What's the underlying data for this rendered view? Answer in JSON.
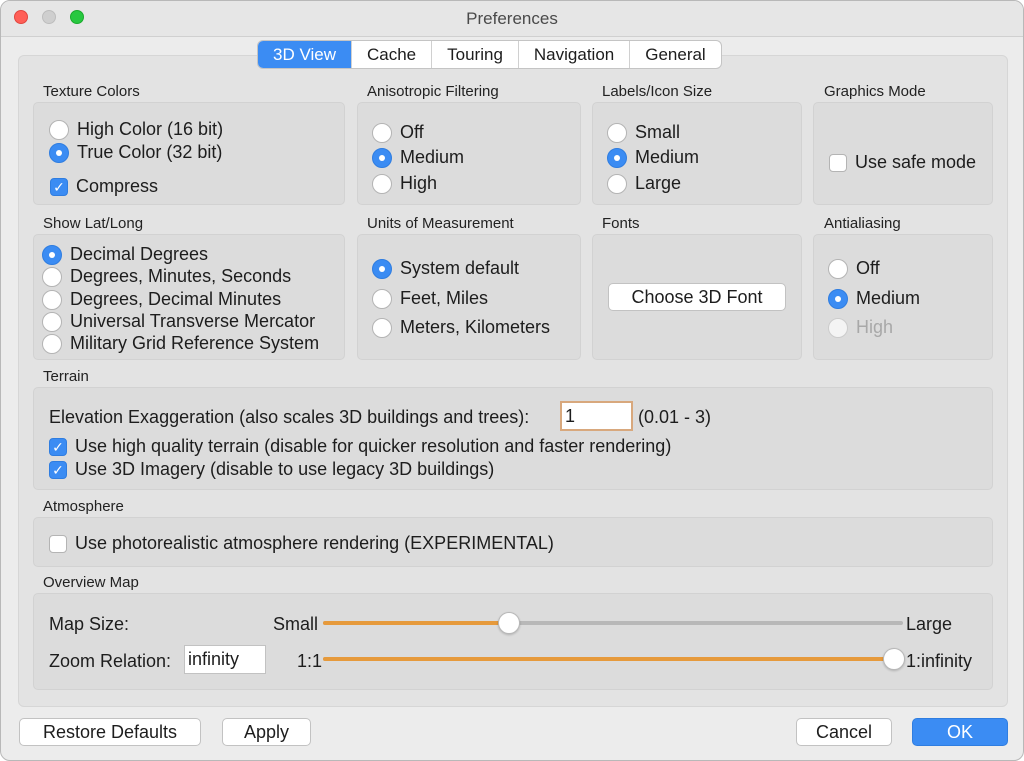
{
  "window": {
    "title": "Preferences"
  },
  "tabs": [
    "3D View",
    "Cache",
    "Touring",
    "Navigation",
    "General"
  ],
  "texture_colors": {
    "title": "Texture Colors",
    "options": [
      "High Color (16 bit)",
      "True Color (32 bit)"
    ],
    "selected": 1,
    "compress_label": "Compress",
    "compress_checked": true
  },
  "anisotropic": {
    "title": "Anisotropic Filtering",
    "options": [
      "Off",
      "Medium",
      "High"
    ],
    "selected": 1
  },
  "labels_icon": {
    "title": "Labels/Icon Size",
    "options": [
      "Small",
      "Medium",
      "Large"
    ],
    "selected": 1
  },
  "graphics_mode": {
    "title": "Graphics Mode",
    "safe_mode_label": "Use safe mode",
    "safe_mode_checked": false
  },
  "lat_long": {
    "title": "Show Lat/Long",
    "options": [
      "Decimal Degrees",
      "Degrees, Minutes, Seconds",
      "Degrees, Decimal Minutes",
      "Universal Transverse Mercator",
      "Military Grid Reference System"
    ],
    "selected": 0
  },
  "units": {
    "title": "Units of Measurement",
    "options": [
      "System default",
      "Feet, Miles",
      "Meters, Kilometers"
    ],
    "selected": 0
  },
  "fonts": {
    "title": "Fonts",
    "button_label": "Choose 3D Font"
  },
  "antialiasing": {
    "title": "Antialiasing",
    "options": [
      "Off",
      "Medium",
      "High"
    ],
    "selected": 1
  },
  "terrain": {
    "title": "Terrain",
    "elevation_label": "Elevation Exaggeration (also scales 3D buildings and trees):",
    "elevation_value": "1",
    "elevation_range": "(0.01 - 3)",
    "high_quality_label": "Use high quality terrain (disable for quicker resolution and faster rendering)",
    "high_quality_checked": true,
    "imagery_label": "Use 3D Imagery (disable to use legacy 3D buildings)",
    "imagery_checked": true
  },
  "atmosphere": {
    "title": "Atmosphere",
    "photoreal_label": "Use photorealistic atmosphere rendering (EXPERIMENTAL)",
    "photoreal_checked": false
  },
  "overview_map": {
    "title": "Overview Map",
    "map_size_label": "Map Size:",
    "size_min_label": "Small",
    "size_max_label": "Large",
    "size_value": 0.32,
    "zoom_label": "Zoom Relation:",
    "zoom_value": "infinity",
    "zoom_min_label": "1:1",
    "zoom_max_label": "1:infinity",
    "zoom_slider_value": 1.0
  },
  "footer": {
    "restore_label": "Restore Defaults",
    "apply_label": "Apply",
    "cancel_label": "Cancel",
    "ok_label": "OK"
  }
}
